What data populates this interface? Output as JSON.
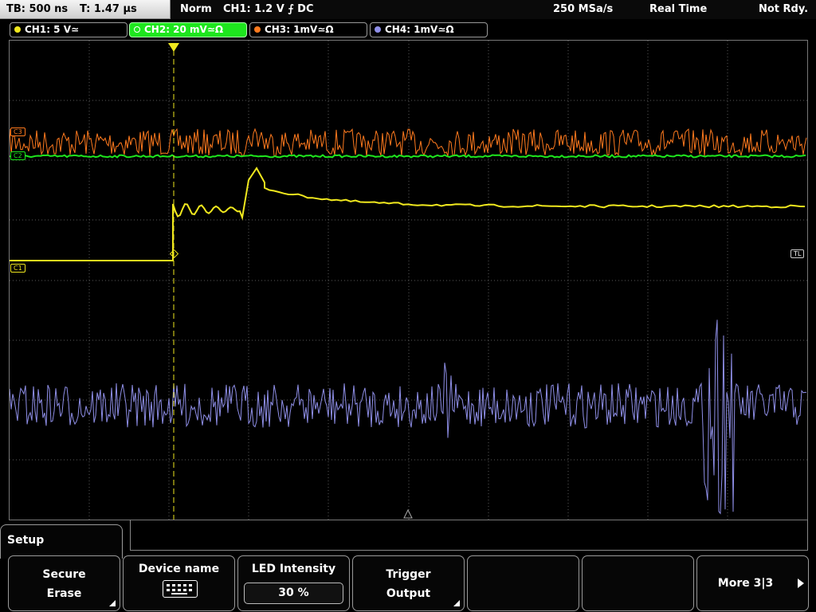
{
  "status": {
    "timebase": "TB: 500 ns",
    "trigger_time": "T: 1.47 µs",
    "mode": "Norm",
    "trigger_info": "CH1: 1.2 V ⨍ DC",
    "sample_rate": "250 MSa/s",
    "acq_mode": "Real Time",
    "run_state": "Not Rdy."
  },
  "channels": [
    {
      "label": "CH1: 5 V≃",
      "color": "#f0e81e",
      "active": false
    },
    {
      "label": "CH2: 20 mV≃Ω",
      "color": "#1ee61e",
      "active": true
    },
    {
      "label": "CH3: 1mV≃Ω",
      "color": "#ff7a1e",
      "active": false
    },
    {
      "label": "CH4: 1mV≃Ω",
      "color": "#8f8fe8",
      "active": false
    }
  ],
  "markers": {
    "c3": "C3",
    "c2": "C2",
    "c1": "C1",
    "tl": "TL"
  },
  "menu": {
    "title": "Setup",
    "softkeys": [
      {
        "line1": "Secure",
        "line2": "Erase"
      },
      {
        "line1": "Device name",
        "icon": "keyboard-icon"
      },
      {
        "line1": "LED Intensity",
        "value": "30 %"
      },
      {
        "line1": "Trigger",
        "line2": "Output"
      },
      {
        "line1": ""
      },
      {
        "line1": ""
      },
      {
        "line1": "More 3|3"
      }
    ]
  },
  "colors": {
    "ch1": "#f0e81e",
    "ch2": "#1ee61e",
    "ch3": "#ff7a1e",
    "ch4": "#8f8fe8",
    "grid": "#5a5a5a"
  }
}
